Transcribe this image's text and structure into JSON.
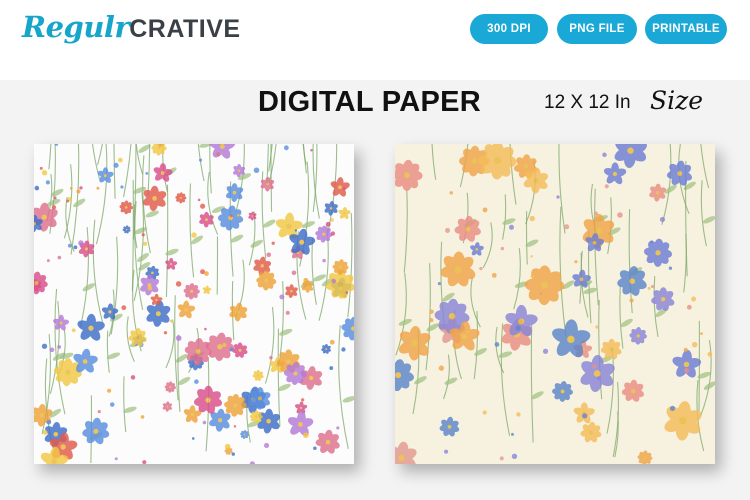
{
  "brand": {
    "script": "Regulr",
    "block": "CRATIVE"
  },
  "badges": [
    "300 DPI",
    "PNG FILE",
    "PRINTABLE"
  ],
  "title": "DIGITAL PAPER",
  "size": {
    "label": "12 X 12 In",
    "word": "Size"
  },
  "colors": {
    "accent": "#1aa8d6",
    "logo_script": "#17a6c9",
    "logo_block": "#3b3f47"
  },
  "papers": [
    {
      "name": "wildflower-pattern-white",
      "background": "#fbfcfb"
    },
    {
      "name": "wildflower-pattern-cream",
      "background": "#f7f2e0"
    }
  ]
}
